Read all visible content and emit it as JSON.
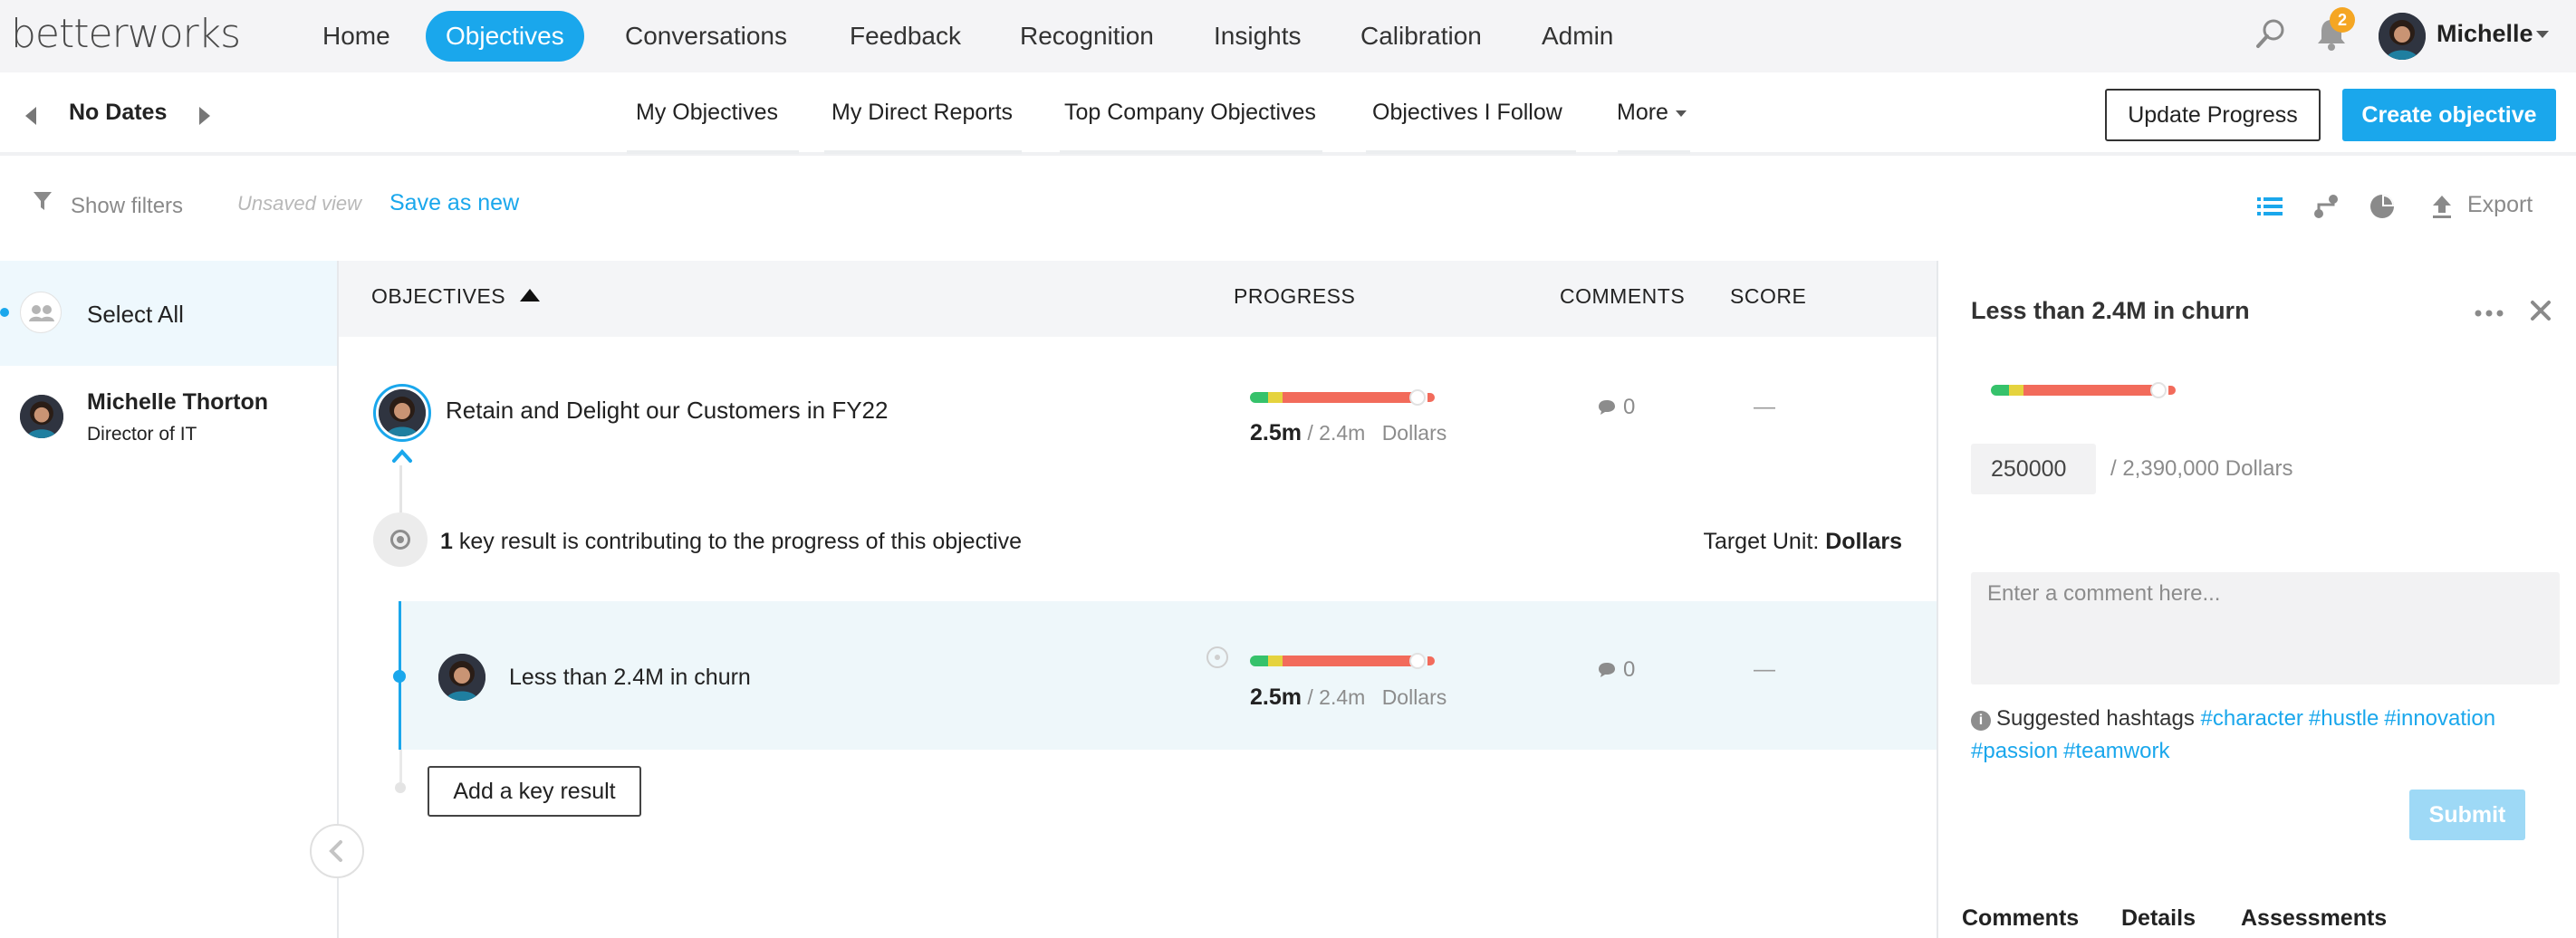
{
  "app": {
    "logo": "betterworks"
  },
  "nav": {
    "items": [
      {
        "label": "Home",
        "active": false
      },
      {
        "label": "Objectives",
        "active": true
      },
      {
        "label": "Conversations",
        "active": false
      },
      {
        "label": "Feedback",
        "active": false
      },
      {
        "label": "Recognition",
        "active": false
      },
      {
        "label": "Insights",
        "active": false
      },
      {
        "label": "Calibration",
        "active": false
      },
      {
        "label": "Admin",
        "active": false
      }
    ],
    "notification_count": "2",
    "user_name": "Michelle"
  },
  "subbar": {
    "date_label": "No Dates",
    "tabs": [
      "My Objectives",
      "My Direct Reports",
      "Top Company Objectives",
      "Objectives I Follow",
      "More"
    ],
    "update_progress": "Update Progress",
    "create_objective": "Create objective"
  },
  "filters": {
    "show_filters": "Show filters",
    "unsaved_view": "Unsaved view",
    "save_as_new": "Save as new",
    "export": "Export"
  },
  "people": {
    "select_all": "Select All",
    "person": {
      "name": "Michelle Thorton",
      "title": "Director of IT"
    }
  },
  "table": {
    "headers": {
      "objectives": "OBJECTIVES",
      "progress": "PROGRESS",
      "comments": "COMMENTS",
      "score": "SCORE"
    },
    "objective": {
      "title": "Retain and Delight our Customers in FY22",
      "progress_value": "2.5m",
      "progress_target": "/ 2.4m",
      "progress_unit": "Dollars",
      "comments": "0",
      "score": "—"
    },
    "kr_summary": {
      "count": "1",
      "text": " key result is contributing to the progress of this objective",
      "target_unit_label": "Target Unit: ",
      "target_unit": "Dollars"
    },
    "key_result": {
      "title": "Less than 2.4M in churn",
      "progress_value": "2.5m",
      "progress_target": "/ 2.4m",
      "progress_unit": "Dollars",
      "comments": "0",
      "score": "—"
    },
    "add_key_result": "Add a key result"
  },
  "detail": {
    "title": "Less than 2.4M in churn",
    "current_value": "250000",
    "target_text": "/ 2,390,000 Dollars",
    "comment_placeholder": "Enter a comment here...",
    "suggested_label": "Suggested hashtags",
    "hashtags": [
      "#character",
      "#hustle",
      "#innovation",
      "#passion",
      "#teamwork"
    ],
    "submit": "Submit",
    "tabs": [
      "Comments",
      "Details",
      "Assessments"
    ]
  },
  "colors": {
    "accent": "#1aa7ec",
    "progress_green": "#36c26b",
    "progress_yellow": "#e5d33e",
    "progress_red": "#f26b5b",
    "badge": "#f5a623"
  }
}
